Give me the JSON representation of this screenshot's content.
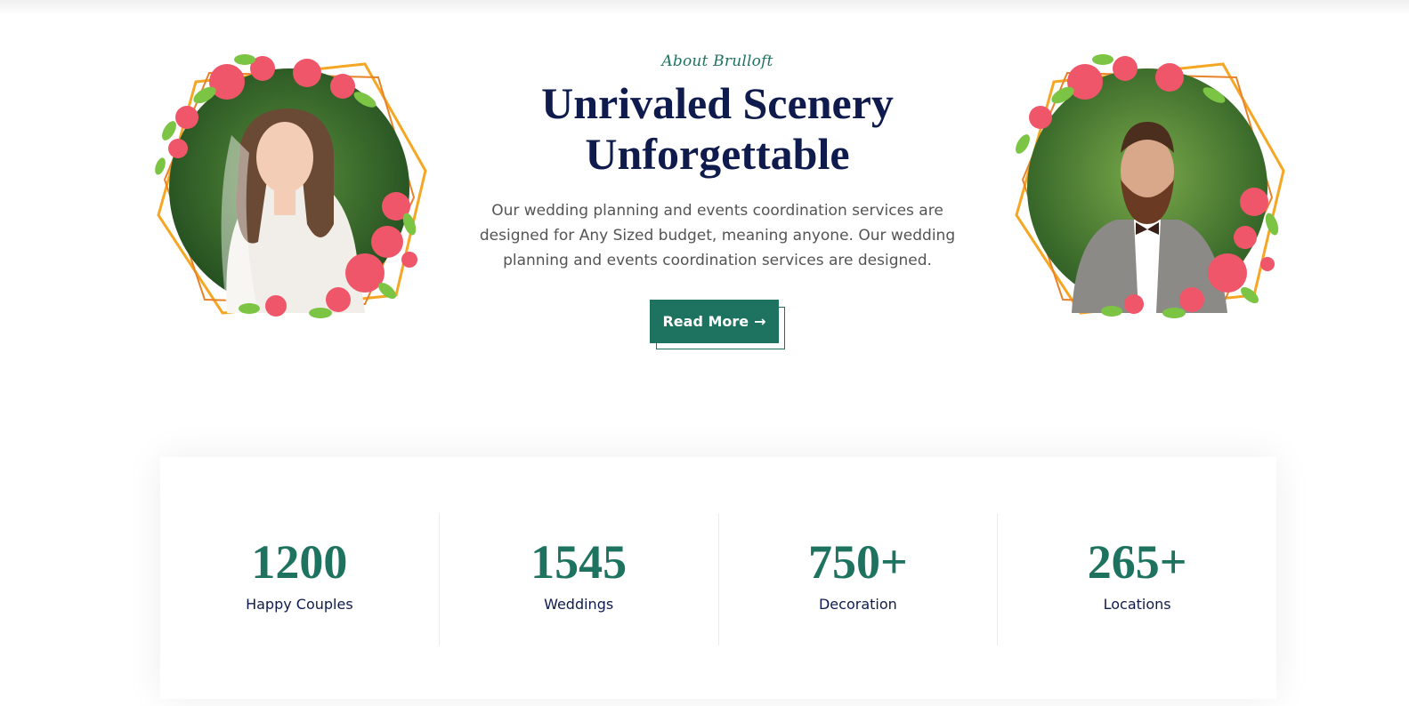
{
  "about": {
    "subtitle": "About Brulloft",
    "headline_line1": "Unrivaled Scenery",
    "headline_line2": "Unforgettable",
    "description": "Our wedding planning and events coordination services are designed for Any Sized budget, meaning anyone. Our wedding planning and events coordination services are designed.",
    "button_label": "Read More",
    "button_icon": "arrow-right-icon"
  },
  "portraits": {
    "left": {
      "subject": "bride-photo",
      "icon": "floral-frame"
    },
    "right": {
      "subject": "groom-photo",
      "icon": "floral-frame"
    }
  },
  "counters": [
    {
      "value": "1200",
      "label": "Happy Couples"
    },
    {
      "value": "1545",
      "label": "Weddings"
    },
    {
      "value": "750+",
      "label": "Decoration"
    },
    {
      "value": "265+",
      "label": "Locations"
    }
  ],
  "colors": {
    "accent": "#1e7360",
    "heading": "#0f1b4c",
    "text": "#545454",
    "flower": "#f0566a",
    "leaf": "#7cc444",
    "gold": "#f5a623"
  }
}
